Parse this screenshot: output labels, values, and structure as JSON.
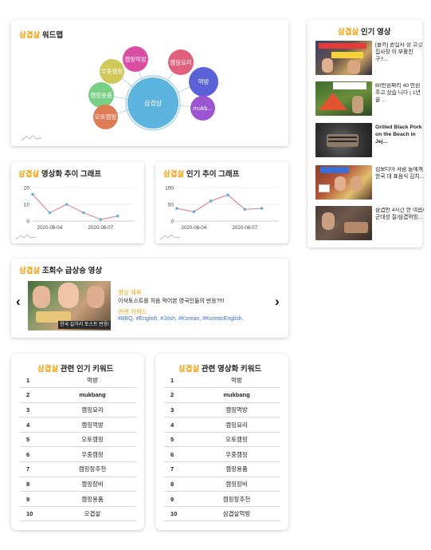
{
  "wordmap": {
    "title_hl": "삼겹살",
    "title_rest": " 워드맵",
    "center": "삼겹살",
    "bubbles": [
      "캠핑먹방",
      "우중캠핑",
      "캠핑용품",
      "오토캠핑",
      "캠핑요리",
      "먹방",
      "mukb..."
    ],
    "colors": {
      "center": "#5cb3dd",
      "pink": "#d94ea2",
      "olive": "#cfc95a",
      "green": "#79cf85",
      "orange": "#de7b55",
      "rose": "#e0607e",
      "blue": "#5a62d6",
      "purple": "#9c55d0"
    }
  },
  "popular_videos": {
    "title_hl": "삼겹살",
    "title_rest": " 인기 영상",
    "items": [
      {
        "title": "[몰카] 퀸집사 장 고깃집사장 이 부활친구?..."
      },
      {
        "title": "80만원짜리 40 만원주고 샀습 니다 | 1년을 ..."
      },
      {
        "title": "Grilled Black Pork on the Beach in Jej..."
      },
      {
        "title": "킴보디아 사람 들에게 한국 대 표음식 김치..."
      },
      {
        "title": "삼겹만 4시간 한 여름/군대성 질/삼겹먹방..."
      }
    ]
  },
  "trend_video": {
    "title_hl": "삼겹살",
    "title_rest": " 영상화 추이 그래프",
    "chart_data": {
      "type": "line",
      "x": [
        "2020-08-03",
        "2020-08-04",
        "2020-08-05",
        "2020-08-06",
        "2020-08-07",
        "2020-08-08",
        "2020-08-09"
      ],
      "y": [
        16,
        5,
        10,
        5,
        1,
        3,
        null
      ],
      "xticks": [
        "2020-08-04",
        "2020-08-07"
      ],
      "yticks": [
        0,
        10,
        20
      ],
      "ylim": [
        0,
        20
      ],
      "grid": true
    }
  },
  "trend_popular": {
    "title_hl": "삼겹살",
    "title_rest": " 인기 추이 그래프",
    "chart_data": {
      "type": "line",
      "x": [
        "2020-08-03",
        "2020-08-04",
        "2020-08-05",
        "2020-08-06",
        "2020-08-07",
        "2020-08-08",
        "2020-08-09"
      ],
      "y": [
        38,
        28,
        60,
        78,
        35,
        38,
        null
      ],
      "xticks": [
        "2020-08-04",
        "2020-08-07"
      ],
      "yticks": [
        0,
        50,
        100
      ],
      "ylim": [
        0,
        100
      ],
      "grid": true
    }
  },
  "surge": {
    "title_hl": "삼겹살",
    "title_rest": " 조회수 급상승 영상",
    "thumb_caption": "한국 길거리 토스트 반응!",
    "video_label": "영상 제목",
    "video_title": "이삭토스트를 처음 먹어본 영국인들의 반응?!!!",
    "kw_label": "관련 키워드",
    "keywords": "#BBQ, #English, #Josh, #Korean, #KoreanEnglish,",
    "prev": "‹",
    "next": "›"
  },
  "related_keywords": {
    "title_hl": "삼겹살",
    "title_rest": " 관련 인기 키워드",
    "rows": [
      [
        "1",
        "먹방"
      ],
      [
        "2",
        "mukbang"
      ],
      [
        "3",
        "캠핑요리"
      ],
      [
        "4",
        "캠핑먹방"
      ],
      [
        "5",
        "오토캠핑"
      ],
      [
        "6",
        "우중캠핑"
      ],
      [
        "7",
        "캠핑장추천"
      ],
      [
        "8",
        "캠핑장비"
      ],
      [
        "9",
        "캠핑용품"
      ],
      [
        "10",
        "오겹살"
      ]
    ]
  },
  "video_keywords": {
    "title_hl": "삼겹살",
    "title_rest": " 관련 영상화 키워드",
    "rows": [
      [
        "1",
        "먹방"
      ],
      [
        "2",
        "mukbang"
      ],
      [
        "3",
        "캠핑먹방"
      ],
      [
        "4",
        "캠핑요리"
      ],
      [
        "5",
        "오토캠핑"
      ],
      [
        "6",
        "우중캠핑"
      ],
      [
        "7",
        "캠핑용품"
      ],
      [
        "8",
        "캠핑장비"
      ],
      [
        "9",
        "캠핑장추천"
      ],
      [
        "10",
        "삼겹살먹방"
      ]
    ]
  }
}
